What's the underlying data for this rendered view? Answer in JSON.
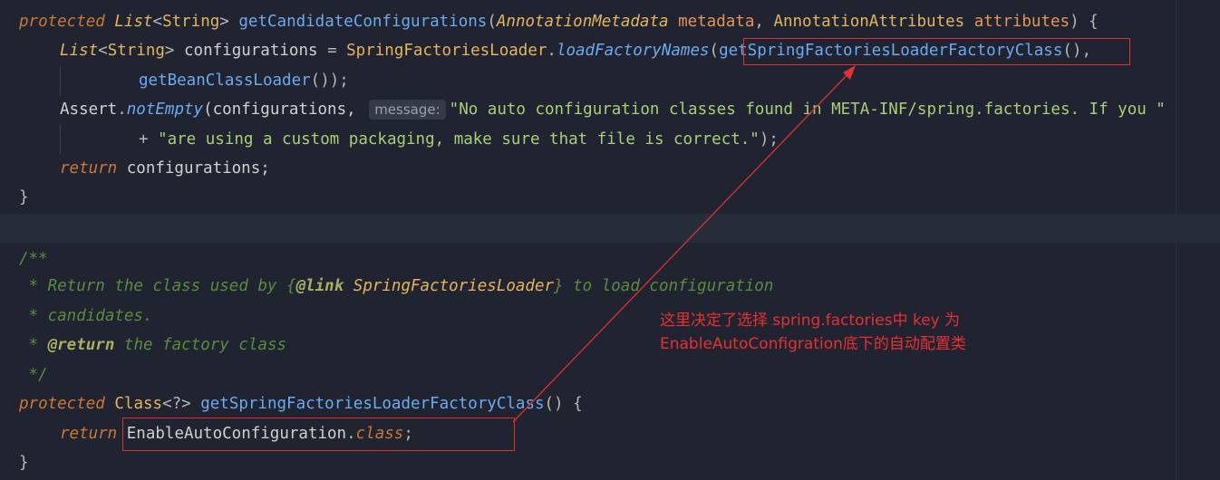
{
  "colors": {
    "background": "#1f2430",
    "keyword": "#cc7832",
    "type": "#e6b45a",
    "method": "#6aabf0",
    "string": "#a9cf74",
    "doc_comment": "#5a8c3e",
    "annotation_red": "#e03030"
  },
  "method1": {
    "kw_protected": "protected",
    "type_list": "List",
    "generic_open": "<",
    "type_string": "String",
    "generic_close": ">",
    "name": "getCandidateConfigurations",
    "paren_open": "(",
    "p1_type": "AnnotationMetadata",
    "p1_name": "metadata",
    "comma": ", ",
    "p2_type": "AnnotationAttributes",
    "p2_name": "attributes",
    "paren_close_brace": ") {",
    "line2_var": "configurations",
    "line2_eq": " = ",
    "line2_class": "SpringFactoriesLoader",
    "dot": ".",
    "line2_method": "loadFactoryNames",
    "line2_arg": "getSpringFactoriesLoaderFactoryClass",
    "line2_end": "(),",
    "line3_method": "getBeanClassLoader",
    "line3_end": "());",
    "assert_class": "Assert",
    "assert_method": "notEmpty",
    "assert_open": "(configurations,",
    "param_hint": "message:",
    "msg1": "\"No auto configuration classes found in META-INF/spring.factories. If you \"",
    "plus": "+ ",
    "msg2": "\"are using a custom packaging, make sure that file is correct.\"",
    "msg2_end": ");",
    "kw_return": "return",
    "return_value": " configurations;",
    "close_brace": "}"
  },
  "javadoc": {
    "open": "/**",
    "l1_prefix": " * Return the class used by ",
    "l1_link_open": "{",
    "l1_link_tag": "@link",
    "l1_link_ref": " SpringFactoriesLoader",
    "l1_link_close": "}",
    "l1_suffix": " to load configuration",
    "l2": " * candidates.",
    "l3_prefix": " * ",
    "l3_tag": "@return",
    "l3_suffix": " the factory class",
    "close": " */"
  },
  "method2": {
    "kw_protected": "protected",
    "type_class": "Class",
    "generic": "<?>",
    "name": "getSpringFactoriesLoaderFactoryClass",
    "sig_end": "() {",
    "kw_return": "return",
    "return_class": "EnableAutoConfiguration",
    "dot": ".",
    "kw_class": "class",
    "semicolon": ";",
    "close_brace": "}"
  },
  "annotation_note": {
    "line1": "这里决定了选择 spring.factories中 key 为",
    "line2": "EnableAutoConfigration底下的自动配置类"
  }
}
